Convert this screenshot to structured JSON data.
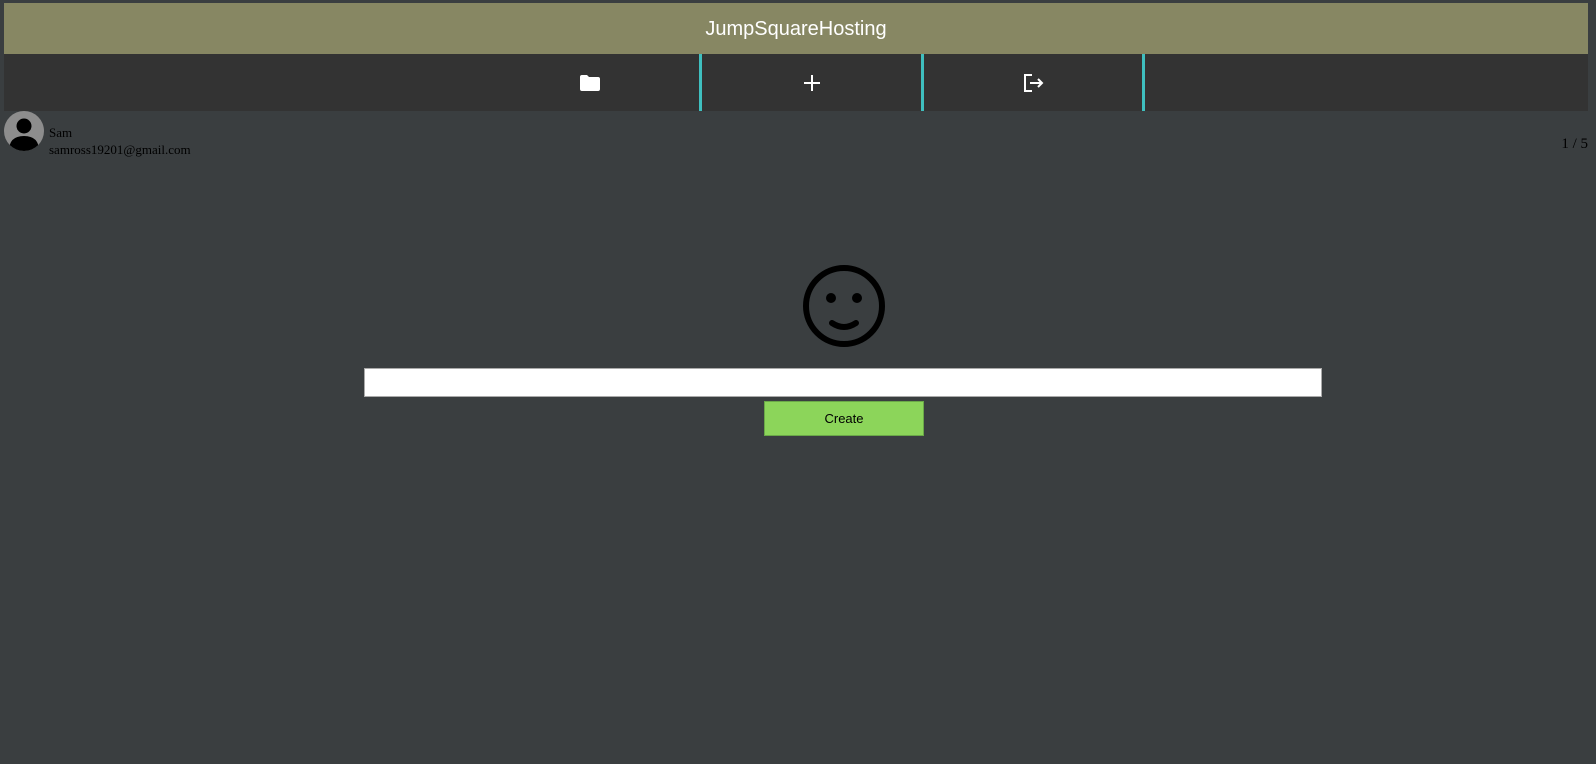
{
  "app": {
    "title": "JumpSquareHosting"
  },
  "nav": {
    "items": [
      {
        "icon": "folder-icon",
        "label": "Files"
      },
      {
        "icon": "plus-icon",
        "label": "Create"
      },
      {
        "icon": "logout-icon",
        "label": "Logout"
      }
    ],
    "divider_color": "#3fbfbf",
    "background": "#333333"
  },
  "user": {
    "name": "Sam",
    "email": "samross19201@gmail.com",
    "avatar_icon": "user-avatar-icon"
  },
  "pagination": {
    "text": "1 / 5"
  },
  "status_icon": "smiley-face-icon",
  "create_form": {
    "input_value": "",
    "input_placeholder": "",
    "button_label": "Create"
  },
  "colors": {
    "header_bg": "#878763",
    "page_bg": "#3a3e40",
    "button_bg": "#8cd55a"
  }
}
